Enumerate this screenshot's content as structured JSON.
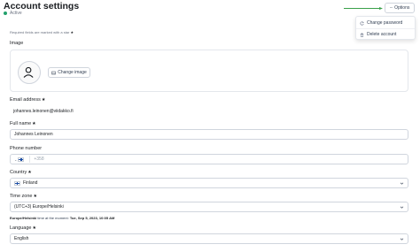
{
  "header": {
    "title": "Account settings",
    "status": "Active",
    "options_label": "Options"
  },
  "menu": {
    "items": [
      {
        "label": "Change password",
        "icon": "refresh-icon"
      },
      {
        "label": "Delete account",
        "icon": "trash-icon"
      }
    ]
  },
  "form": {
    "required_hint": "Required fields are marked with a star",
    "required_marker": "★",
    "image": {
      "label": "Image",
      "change_label": "Change image"
    },
    "email": {
      "label": "Email address",
      "value": "johannes.leinonen@viidakko.fi"
    },
    "full_name": {
      "label": "Full name",
      "value": "Johannes Leinonen"
    },
    "phone": {
      "label": "Phone number",
      "placeholder": "+358"
    },
    "country": {
      "label": "Country",
      "value": "Finland"
    },
    "time_zone": {
      "label": "Time zone",
      "value": "(UTC+3) Europe/Helsinki",
      "note_zone": "Europe/Helsinki",
      "note_text": "time at the moment:",
      "note_time": "Tue, Sep 5, 2023, 10:05 AM"
    },
    "language": {
      "label": "Language",
      "value": "English"
    }
  },
  "colors": {
    "status_green": "#22a06b",
    "arrow_green": "#3aa04a",
    "flag_blue": "#1d4fa6"
  }
}
